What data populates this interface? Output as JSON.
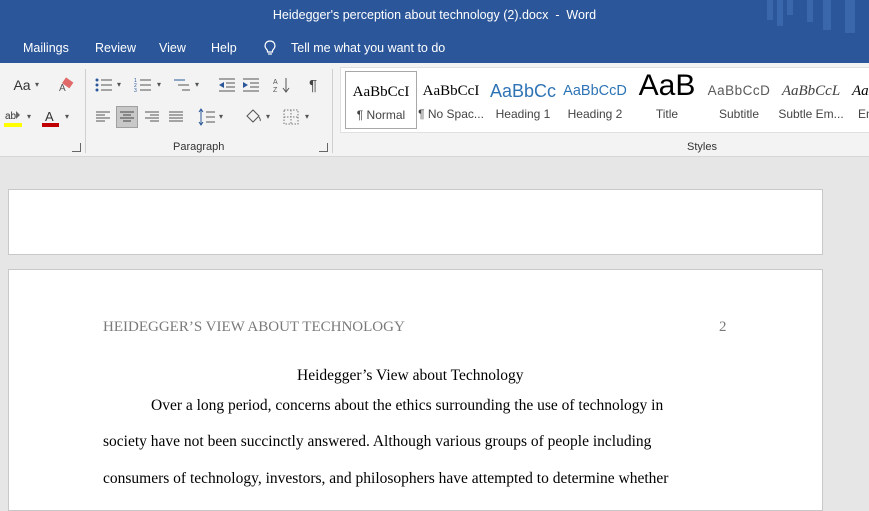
{
  "window": {
    "title": "Heidegger's perception about technology (2).docx  -  Word"
  },
  "menu": {
    "items": [
      "Mailings",
      "Review",
      "View",
      "Help"
    ],
    "tell_me": "Tell me what you want to do"
  },
  "ribbon": {
    "font_aa": "Aa",
    "paragraph_label": "Paragraph",
    "styles_label": "Styles",
    "styles": [
      {
        "preview": "AaBbCcI",
        "label": "¶ Normal"
      },
      {
        "preview": "AaBbCcI",
        "label": "¶ No Spac..."
      },
      {
        "preview": "AaBbCc",
        "label": "Heading 1"
      },
      {
        "preview": "AaBbCcD",
        "label": "Heading 2"
      },
      {
        "preview": "AaB",
        "label": "Title"
      },
      {
        "preview": "AaBbCcD",
        "label": "Subtitle"
      },
      {
        "preview": "AaBbCcL",
        "label": "Subtle Em..."
      },
      {
        "preview": "AaB",
        "label": "Em"
      }
    ]
  },
  "document": {
    "running_head": "HEIDEGGER’S VIEW ABOUT TECHNOLOGY",
    "page_number": "2",
    "title": "Heidegger’s View about Technology",
    "lines": [
      "Over a long period, concerns about the ethics surrounding the use of technology in",
      "society have not been succinctly answered. Although various groups of people including",
      "consumers of technology, investors, and philosophers have attempted to determine whether"
    ]
  },
  "colors": {
    "title_bar": "#2b579a",
    "ribbon": "#f3f3f3",
    "canvas": "#e6e6e6"
  }
}
